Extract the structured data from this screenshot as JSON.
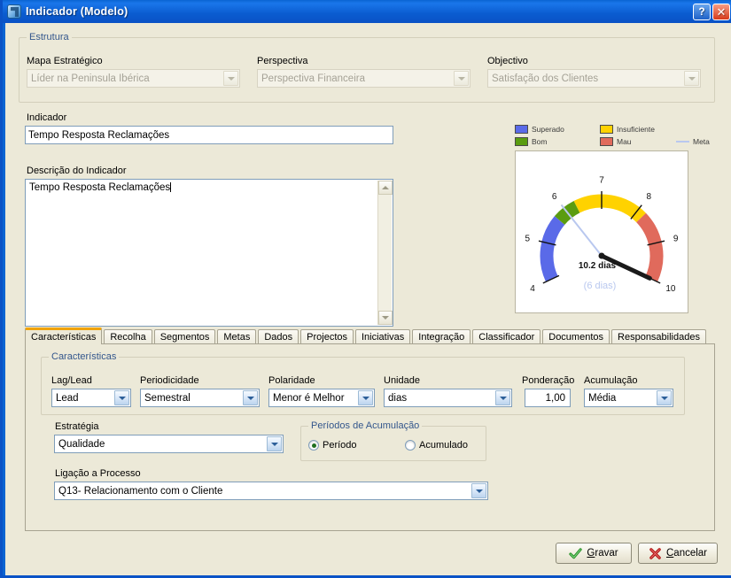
{
  "window": {
    "title": "Indicador (Modelo)",
    "help_label": "?",
    "close_label": "✕"
  },
  "estrutura": {
    "legend": "Estrutura",
    "mapa_label": "Mapa Estratégico",
    "mapa_value": "Líder na Peninsula Ibérica",
    "perspectiva_label": "Perspectiva",
    "perspectiva_value": "Perspectiva Financeira",
    "objectivo_label": "Objectivo",
    "objectivo_value": "Satisfação dos Clientes"
  },
  "indicador": {
    "label": "Indicador",
    "value": "Tempo Resposta Reclamações",
    "descricao_label": "Descrição do Indicador",
    "descricao_value": "Tempo Resposta Reclamações"
  },
  "gauge_legend": {
    "superado": "Superado",
    "insuficiente": "Insuficiente",
    "bom": "Bom",
    "mau": "Mau",
    "meta": "Meta",
    "colors": {
      "superado": "#5a6ae8",
      "insuficiente": "#ffd200",
      "bom": "#5a9c10",
      "mau": "#e06a5c",
      "meta": "#b9c8ef"
    }
  },
  "chart_data": {
    "type": "gauge",
    "title": "",
    "value": 10.2,
    "value_label": "10.2 dias",
    "target": 6,
    "target_label": "(6 dias)",
    "unit": "dias",
    "axis_min": 4,
    "axis_max": 10,
    "ticks": [
      4,
      5,
      6,
      7,
      8,
      9,
      10
    ],
    "tick_labels": [
      "4",
      "5",
      "6",
      "7",
      "8",
      "9",
      "10"
    ],
    "bands": [
      {
        "name": "Superado",
        "from": 4.0,
        "to": 5.7,
        "color": "#5a6ae8"
      },
      {
        "name": "Bom",
        "from": 5.7,
        "to": 6.3,
        "color": "#5a9c10"
      },
      {
        "name": "Insuficiente",
        "from": 6.3,
        "to": 8.2,
        "color": "#ffd200"
      },
      {
        "name": "Mau",
        "from": 8.2,
        "to": 10.0,
        "color": "#e06a5c"
      }
    ],
    "needle_color": "#1a1a1a",
    "target_needle_color": "#b9c8ef"
  },
  "tabs": [
    {
      "label": "Características",
      "active": true
    },
    {
      "label": "Recolha",
      "active": false
    },
    {
      "label": "Segmentos",
      "active": false
    },
    {
      "label": "Metas",
      "active": false
    },
    {
      "label": "Dados",
      "active": false
    },
    {
      "label": "Projectos",
      "active": false
    },
    {
      "label": "Iniciativas",
      "active": false
    },
    {
      "label": "Integração",
      "active": false
    },
    {
      "label": "Classificador",
      "active": false
    },
    {
      "label": "Documentos",
      "active": false
    },
    {
      "label": "Responsabilidades",
      "active": false
    }
  ],
  "caracteristicas": {
    "legend": "Características",
    "laglead_label": "Lag/Lead",
    "laglead_value": "Lead",
    "periodicidade_label": "Periodicidade",
    "periodicidade_value": "Semestral",
    "polaridade_label": "Polaridade",
    "polaridade_value": "Menor é Melhor",
    "unidade_label": "Unidade",
    "unidade_value": "dias",
    "ponderacao_label": "Ponderação",
    "ponderacao_value": "1,00",
    "acumulacao_label": "Acumulação",
    "acumulacao_value": "Média"
  },
  "estrategia": {
    "label": "Estratégia",
    "value": "Qualidade"
  },
  "periodos": {
    "legend": "Períodos de Acumulação",
    "periodo_label": "Período",
    "acumulado_label": "Acumulado",
    "selected": "Período"
  },
  "ligacao": {
    "label": "Ligação a Processo",
    "value": "Q13- Relacionamento com o Cliente"
  },
  "footer": {
    "gravar_accel": "G",
    "gravar_rest": "ravar",
    "cancelar_accel": "C",
    "cancelar_rest": "ancelar"
  }
}
